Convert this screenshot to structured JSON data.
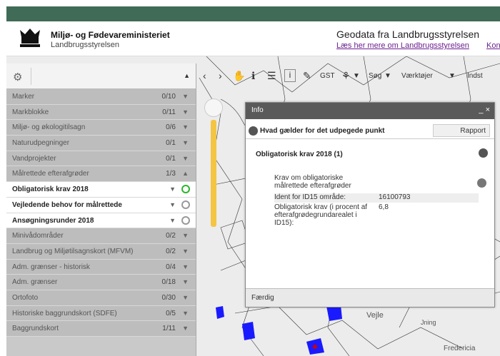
{
  "header": {
    "ministry": "Miljø- og Fødevareministeriet",
    "agency": "Landbrugsstyrelsen",
    "title": "Geodata fra Landbrugsstyrelsen",
    "link": "Læs her mere om Landbrugsstyrelsen",
    "link2": "Kon"
  },
  "toolbar": {
    "gst": "GST",
    "search": "Søg",
    "tools": "Værktøjer",
    "more": "Indst"
  },
  "layers": [
    {
      "name": "Marker",
      "count": "0/10"
    },
    {
      "name": "Markblokke",
      "count": "0/11"
    },
    {
      "name": "Miljø- og økologitilsagn",
      "count": "0/6"
    },
    {
      "name": "Naturudpegninger",
      "count": "0/1"
    },
    {
      "name": "Vandprojekter",
      "count": "0/1"
    },
    {
      "name": "Målrettede efterafgrøder",
      "count": "1/3"
    },
    {
      "name": "Obligatorisk krav 2018",
      "count": ""
    },
    {
      "name": "Vejledende behov for målrettede",
      "count": ""
    },
    {
      "name": "Ansøgningsrunder 2018",
      "count": ""
    },
    {
      "name": "Minivådområder",
      "count": "0/2"
    },
    {
      "name": "Landbrug og Miljøtilsagnskort (MFVM)",
      "count": "0/2"
    },
    {
      "name": "Adm. grænser - historisk",
      "count": "0/4"
    },
    {
      "name": "Adm. grænser",
      "count": "0/18"
    },
    {
      "name": "Ortofoto",
      "count": "0/30"
    },
    {
      "name": "Historiske baggrundskort (SDFE)",
      "count": "0/5"
    },
    {
      "name": "Baggrundskort",
      "count": "1/11"
    }
  ],
  "info": {
    "title": "Info",
    "question": "Hvad gælder for det udpegede punkt",
    "report": "Rapport",
    "section": "Obligatorisk krav 2018 (1)",
    "sub_line1": "Krav om obligatoriske",
    "sub_line2": "målrettede efterafgrøder",
    "rows": [
      {
        "k": "Ident for ID15 område:",
        "v": "16100793"
      },
      {
        "k": "Obligatorisk krav (i procent af efterafgrødegrundarealet i ID15):",
        "v": "6,8"
      }
    ],
    "status": "Færdig"
  }
}
